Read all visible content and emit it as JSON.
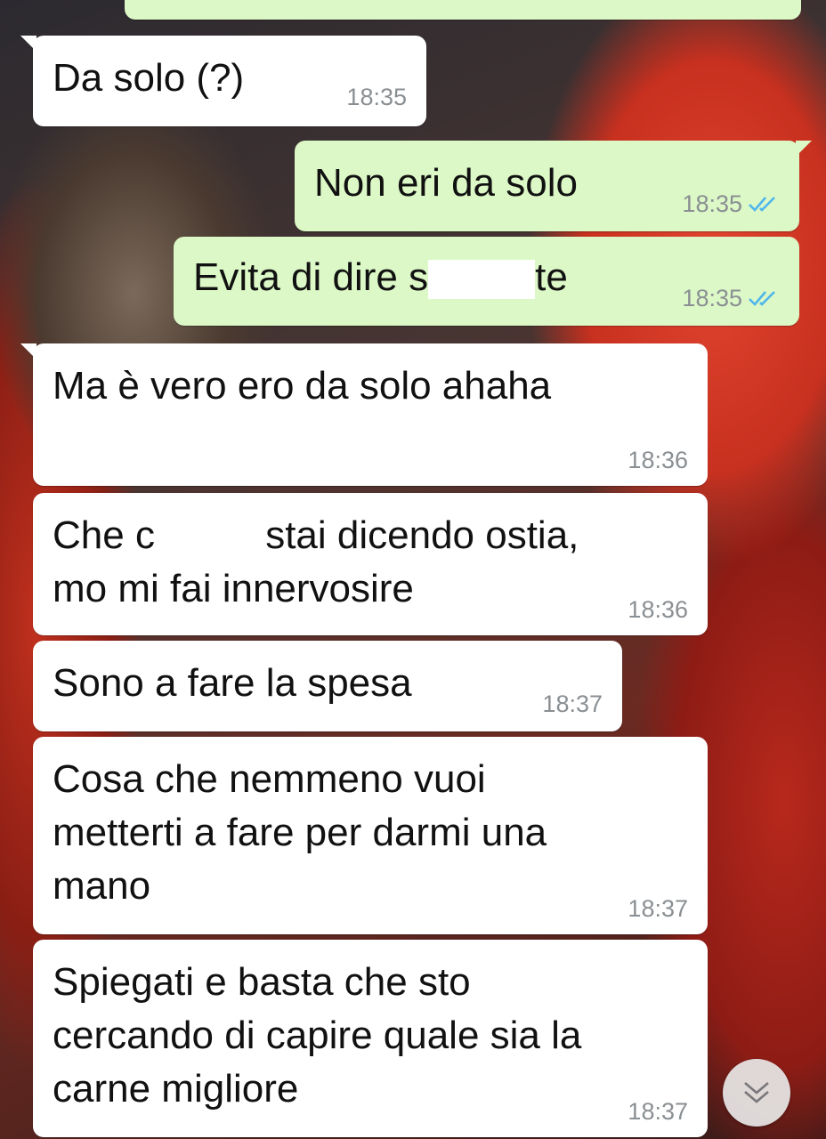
{
  "messages": [
    {
      "direction": "in",
      "text": "Da solo (?)",
      "time": "18:35"
    },
    {
      "direction": "out",
      "text": "Non eri da solo",
      "time": "18:35",
      "status": "read"
    },
    {
      "direction": "out",
      "text_before": "Evita di dire s",
      "text_after": "te",
      "time": "18:35",
      "status": "read"
    },
    {
      "direction": "in",
      "text": "Ma è vero ero da solo ahaha",
      "time": "18:36"
    },
    {
      "direction": "in",
      "text_before": "Che c",
      "text_after": "stai dicendo ostia,\nmo mi fai innervosire",
      "time": "18:36"
    },
    {
      "direction": "in",
      "text": "Sono a fare la spesa",
      "time": "18:37"
    },
    {
      "direction": "in",
      "text": "Cosa che nemmeno vuoi\nmetterti a fare per darmi una\nmano",
      "time": "18:37"
    },
    {
      "direction": "in",
      "text": "Spiegati e basta che sto\ncercando di capire quale sia la\ncarne migliore",
      "time": "18:37"
    }
  ],
  "icons": {
    "read_receipt": "double-check-icon",
    "scroll_down": "double-chevron-down-icon"
  },
  "colors": {
    "incoming_bubble": "#ffffff",
    "outgoing_bubble": "#dcf8c6",
    "timestamp": "#8a8f93",
    "read_tick": "#4fb6ec"
  }
}
